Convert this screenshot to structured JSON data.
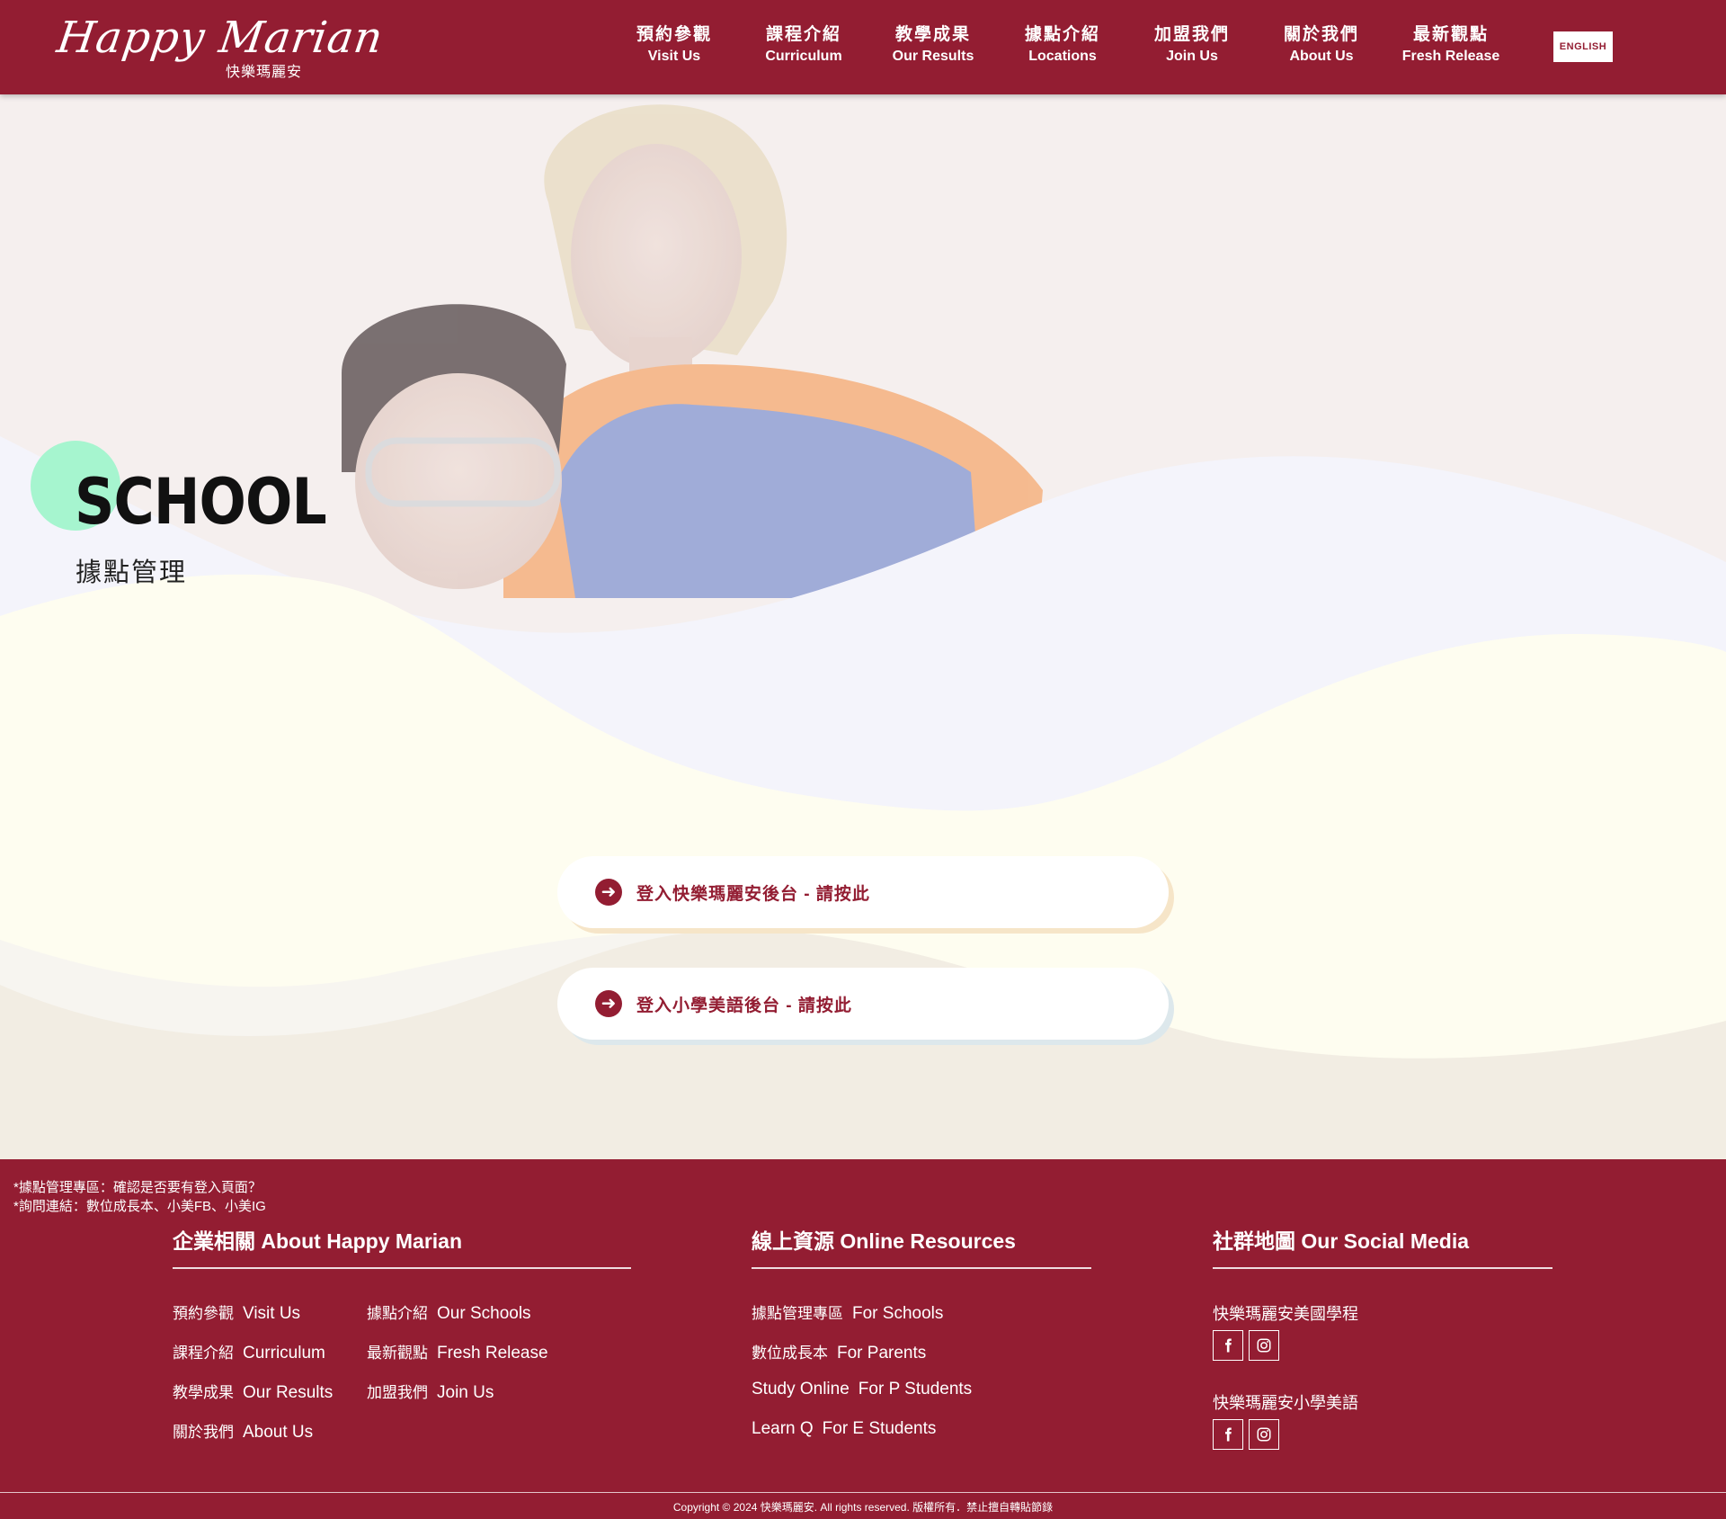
{
  "header": {
    "logo_script": "Happy Marian",
    "logo_sub": "快樂瑪麗安",
    "nav": [
      {
        "zh": "預約參觀",
        "en": "Visit Us"
      },
      {
        "zh": "課程介紹",
        "en": "Curriculum"
      },
      {
        "zh": "教學成果",
        "en": "Our Results"
      },
      {
        "zh": "據點介紹",
        "en": "Locations"
      },
      {
        "zh": "加盟我們",
        "en": "Join Us"
      },
      {
        "zh": "關於我們",
        "en": "About Us"
      },
      {
        "zh": "最新觀點",
        "en": "Fresh Release"
      }
    ],
    "lang_button": "ENGLISH"
  },
  "hero": {
    "title": "SCHOOL",
    "subtitle": "據點管理",
    "cta": [
      {
        "label": "登入快樂瑪麗安後台 - 請按此",
        "icon": "arrow-right-circle-icon"
      },
      {
        "label": "登入小學美語後台 - 請按此",
        "icon": "arrow-right-circle-icon"
      }
    ]
  },
  "footer": {
    "notes": [
      "*據點管理專區：確認是否要有登入頁面？",
      "*詢問連結：數位成長本、小美FB、小美IG"
    ],
    "col1": {
      "title": "企業相關 About Happy Marian",
      "links_left": [
        {
          "zh": "預約參觀",
          "en": "Visit Us"
        },
        {
          "zh": "課程介紹",
          "en": "Curriculum"
        },
        {
          "zh": "教學成果",
          "en": "Our Results"
        },
        {
          "zh": "關於我們",
          "en": "About Us"
        }
      ],
      "links_right": [
        {
          "zh": "據點介紹",
          "en": "Our Schools"
        },
        {
          "zh": "最新觀點",
          "en": "Fresh Release"
        },
        {
          "zh": "加盟我們",
          "en": "Join Us"
        }
      ]
    },
    "col2": {
      "title": "線上資源 Online Resources",
      "links": [
        {
          "zh": "據點管理專區",
          "en": "For Schools"
        },
        {
          "zh": "數位成長本",
          "en": "For Parents"
        },
        {
          "zh": "Study Online",
          "en": "For P Students"
        },
        {
          "zh": "Learn Q",
          "en": "For E Students"
        }
      ]
    },
    "col3": {
      "title": "社群地圖 Our Social Media",
      "groups": [
        {
          "label": "快樂瑪麗安美國學程",
          "icons": [
            "facebook-icon",
            "instagram-icon"
          ]
        },
        {
          "label": "快樂瑪麗安小學美語",
          "icons": [
            "facebook-icon",
            "instagram-icon"
          ]
        }
      ]
    },
    "copyright": "Copyright © 2024 快樂瑪麗安. All rights reserved. 版權所有．禁止擅自轉貼節錄"
  },
  "colors": {
    "brand": "#931d32",
    "mint": "#a6f5cf",
    "cream": "#f2ede3",
    "lavender": "#f4f4fb",
    "yellow": "#fefdf0"
  }
}
